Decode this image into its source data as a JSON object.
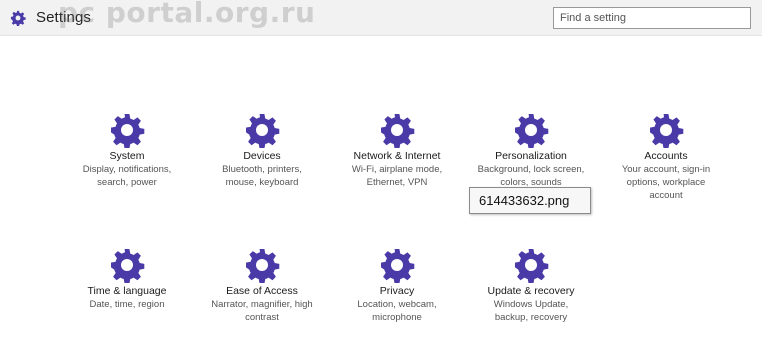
{
  "header": {
    "title": "Settings",
    "watermark": "pc portal.org.ru",
    "search_placeholder": "Find a setting"
  },
  "accent_color": "#4a3aa8",
  "tiles": [
    {
      "name": "System",
      "desc": [
        "Display, notifications,",
        "search, power"
      ],
      "icon": "gear-icon"
    },
    {
      "name": "Devices",
      "desc": [
        "Bluetooth, printers,",
        "mouse, keyboard"
      ],
      "icon": "gear-icon"
    },
    {
      "name": "Network & Internet",
      "desc": [
        "Wi-Fi, airplane mode,",
        "Ethernet, VPN"
      ],
      "icon": "gear-icon"
    },
    {
      "name": "Personalization",
      "desc": [
        "Background, lock screen,",
        "colors, sounds"
      ],
      "icon": "gear-icon"
    },
    {
      "name": "Accounts",
      "desc": [
        "Your account, sign-in",
        "options, workplace",
        "account"
      ],
      "icon": "gear-icon"
    },
    {
      "name": "Time & language",
      "desc": [
        "Date, time, region"
      ],
      "icon": "gear-icon"
    },
    {
      "name": "Ease of Access",
      "desc": [
        "Narrator, magnifier, high",
        "contrast"
      ],
      "icon": "gear-icon"
    },
    {
      "name": "Privacy",
      "desc": [
        "Location, webcam,",
        "microphone"
      ],
      "icon": "gear-icon"
    },
    {
      "name": "Update & recovery",
      "desc": [
        "Windows Update,",
        "backup, recovery"
      ],
      "icon": "gear-icon"
    }
  ],
  "tooltip": "614433632.png"
}
